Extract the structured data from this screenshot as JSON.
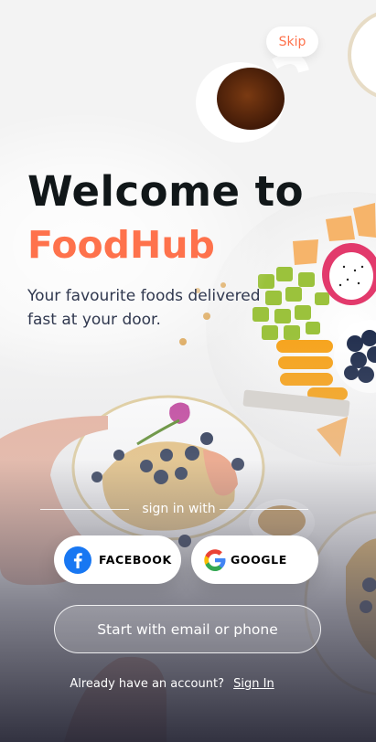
{
  "header": {
    "skip_label": "Skip"
  },
  "hero": {
    "title_line1": "Welcome to",
    "title_line2": "FoodHub",
    "tagline": "Your favourite foods delivered fast at your door."
  },
  "auth": {
    "divider_text": "sign in with",
    "facebook_label": "FACEBOOK",
    "google_label": "GOOGLE",
    "email_button_label": "Start with email or phone"
  },
  "footer": {
    "prompt": "Already have an account?",
    "signin_label": "Sign In"
  },
  "colors": {
    "accent": "#FE724C",
    "title": "#111719",
    "facebook": "#1877F2"
  },
  "icons": [
    "facebook-icon",
    "google-icon"
  ]
}
